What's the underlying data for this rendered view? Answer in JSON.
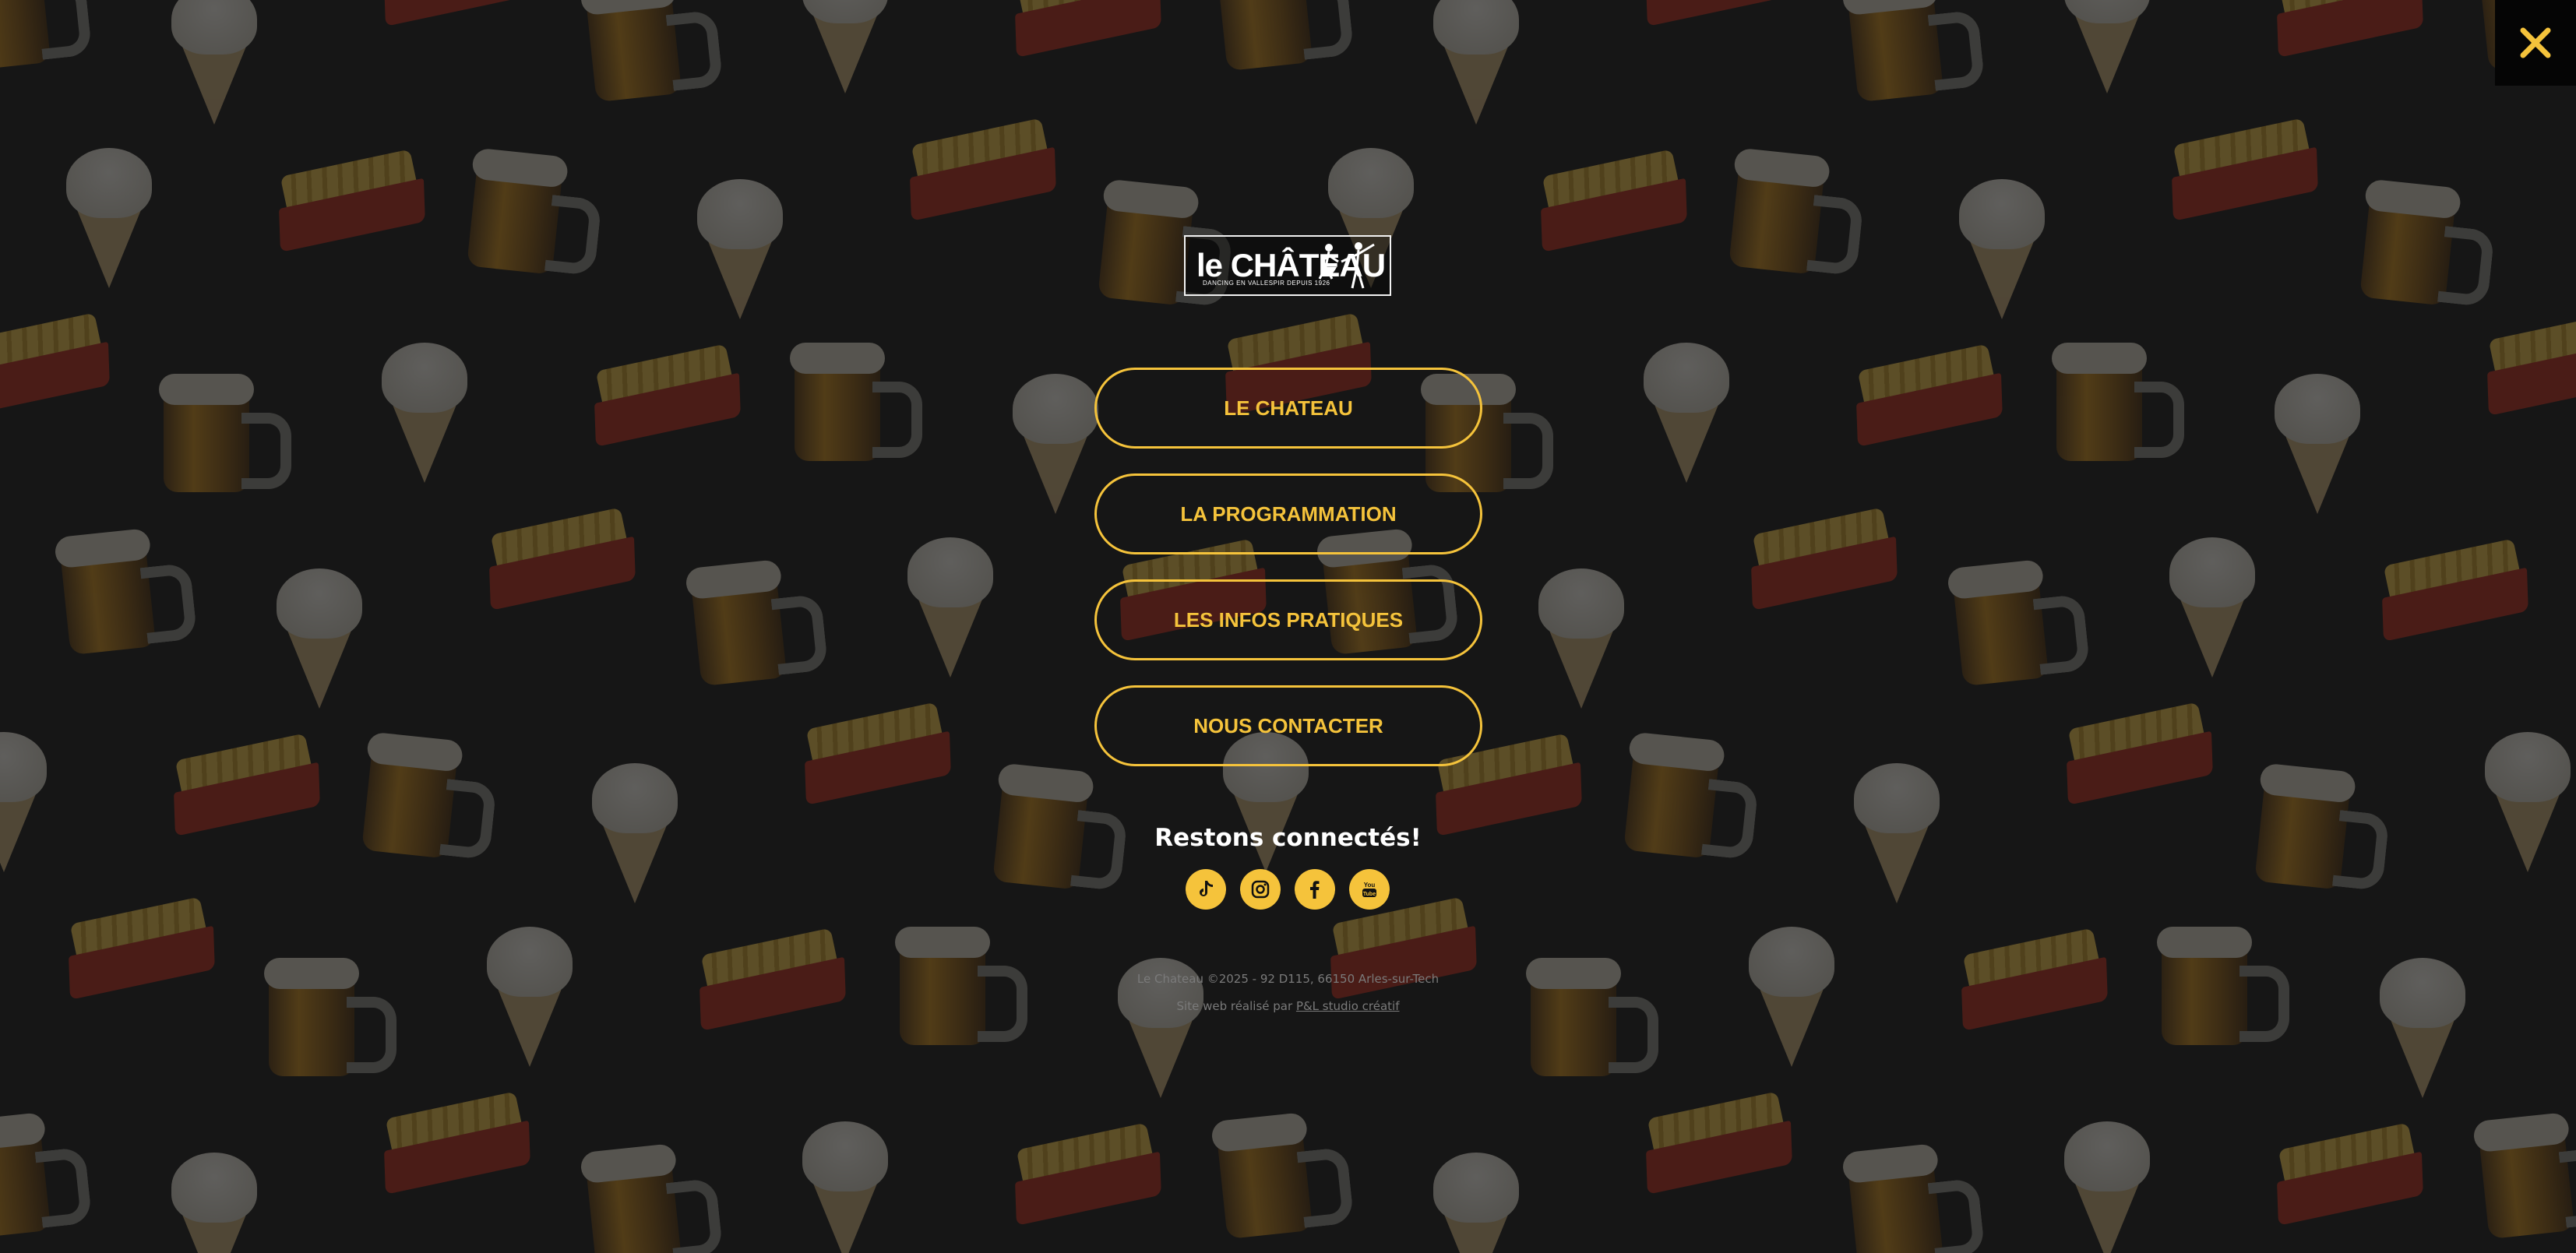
{
  "close_button": {
    "icon": "close-icon",
    "color": "#f5c33b"
  },
  "logo": {
    "name": "le CHÂTEAU",
    "tagline": "DANCING EN VALLESPIR DEPUIS 1926"
  },
  "menu": {
    "items": [
      {
        "label": "LE CHATEAU"
      },
      {
        "label": "LA PROGRAMMATION"
      },
      {
        "label": "LES INFOS PRATIQUES"
      },
      {
        "label": "NOUS CONTACTER"
      }
    ]
  },
  "social": {
    "heading": "Restons connectés!",
    "icons": [
      "tiktok-icon",
      "instagram-icon",
      "facebook-icon",
      "youtube-icon"
    ]
  },
  "footer": {
    "copyright": "Le Chateau ©2025 - 92 D115, 66150 Arles-sur-Tech",
    "credit_prefix": "Site web réalisé par",
    "credit_link": "P&L studio créatif"
  },
  "colors": {
    "accent": "#f5c33b",
    "background": "#161616"
  }
}
